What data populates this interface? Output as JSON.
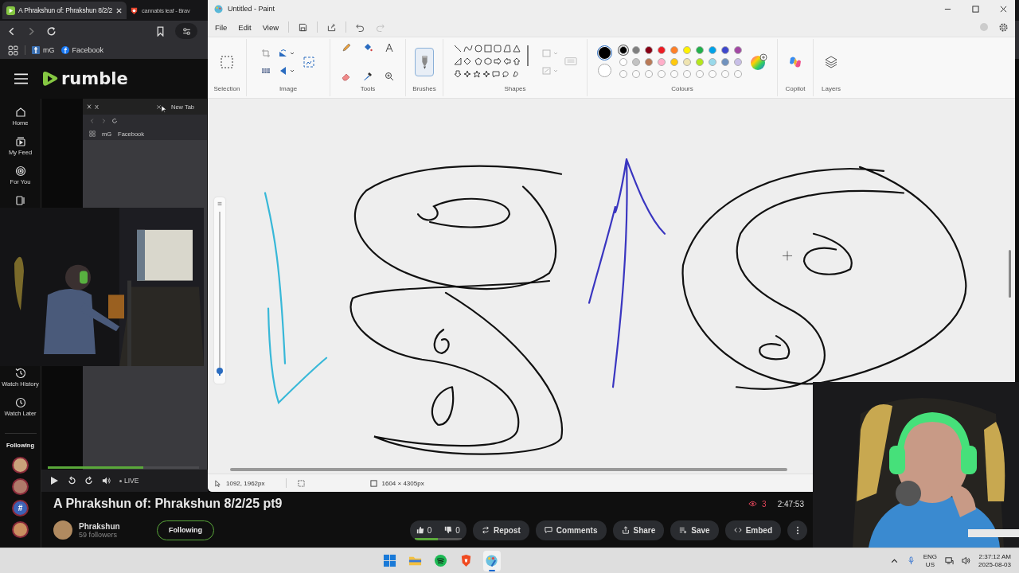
{
  "browser": {
    "tabs": [
      {
        "title": "A Phrakshun of: Phrakshun 8/2/2",
        "kind": "rumble",
        "selected": true
      },
      {
        "title": "cannabis leaf - Brav",
        "kind": "brave",
        "selected": false
      }
    ],
    "bookmarks": [
      {
        "label": "mG",
        "kind": "cross"
      },
      {
        "label": "Facebook",
        "kind": "facebook"
      }
    ]
  },
  "site": {
    "logo": "rumble",
    "sidebar": [
      {
        "label": "Home",
        "kind": "home"
      },
      {
        "label": "My Feed",
        "kind": "feed"
      },
      {
        "label": "For You",
        "kind": "target"
      },
      {
        "kind": "library"
      },
      {
        "label": "Watch History",
        "kind": "history"
      },
      {
        "label": "Watch Later",
        "kind": "clock"
      }
    ],
    "following": {
      "heading": "Following",
      "channels": [
        {
          "kind": "avatar",
          "color": "#c9a27a"
        },
        {
          "kind": "avatar",
          "color": "#b07a6a"
        },
        {
          "kind": "hashtag",
          "glyph": "#",
          "color": "#3d63b8"
        },
        {
          "kind": "avatar",
          "color": "#c98f60"
        }
      ]
    },
    "player": {
      "inner_tabs": [
        "X",
        "New Tab"
      ],
      "inner_bookmarks": [
        "mG",
        "Facebook"
      ],
      "progress": {
        "level": 0.63
      },
      "live_label": "LIVE"
    },
    "video": {
      "title": "A Phrakshun of: Phrakshun 8/2/25 pt9",
      "channel": "Phrakshun",
      "followers": "59 followers",
      "follow_button": "Following",
      "viewers": "3",
      "duration": "2:47:53",
      "likes": "0",
      "dislikes": "0",
      "like_ratio": {
        "level": 0.5
      },
      "actions": [
        {
          "label": "Repost",
          "kind": "repost"
        },
        {
          "label": "Comments",
          "kind": "comments"
        },
        {
          "label": "Share",
          "kind": "share"
        },
        {
          "label": "Save",
          "kind": "save"
        },
        {
          "label": "Embed",
          "kind": "embed"
        }
      ]
    }
  },
  "paint": {
    "title": "Untitled - Paint",
    "menu": [
      "File",
      "Edit",
      "View"
    ],
    "groups": [
      "Selection",
      "Image",
      "Tools",
      "Brushes",
      "Shapes",
      "Colours",
      "Copilot",
      "Layers"
    ],
    "palette": [
      {
        "color": "#000000",
        "selected": true
      },
      {
        "color": "#7f7f7f",
        "selected": false
      },
      {
        "color": "#880015",
        "selected": false
      },
      {
        "color": "#ed1c24",
        "selected": false
      },
      {
        "color": "#ff7f27",
        "selected": false
      },
      {
        "color": "#fff200",
        "selected": false
      },
      {
        "color": "#22b14c",
        "selected": false
      },
      {
        "color": "#00a2e8",
        "selected": false
      },
      {
        "color": "#3f48cc",
        "selected": false
      },
      {
        "color": "#a349a4",
        "selected": false
      },
      {
        "color": "#ffffff",
        "selected": false
      },
      {
        "color": "#c3c3c3",
        "selected": false
      },
      {
        "color": "#b97a57",
        "selected": false
      },
      {
        "color": "#ffaec9",
        "selected": false
      },
      {
        "color": "#ffc90e",
        "selected": false
      },
      {
        "color": "#efe4b0",
        "selected": false
      },
      {
        "color": "#b5e61d",
        "selected": false
      },
      {
        "color": "#99d9ea",
        "selected": false
      },
      {
        "color": "#7092be",
        "selected": false
      },
      {
        "color": "#c8bfe7",
        "selected": false
      }
    ],
    "zoom": {
      "level": 0.03
    },
    "status": {
      "cursor": "1092, 1962px",
      "size": "1604 × 4305px"
    }
  },
  "taskbar": {
    "apps": [
      {
        "kind": "start",
        "selected": false
      },
      {
        "kind": "folder",
        "selected": false
      },
      {
        "kind": "spotify",
        "selected": false
      },
      {
        "kind": "brave",
        "selected": false
      },
      {
        "kind": "paint",
        "selected": true
      }
    ],
    "language": "ENG",
    "region": "US",
    "time": "2:37:12 AM",
    "date": "2025-08-03"
  }
}
